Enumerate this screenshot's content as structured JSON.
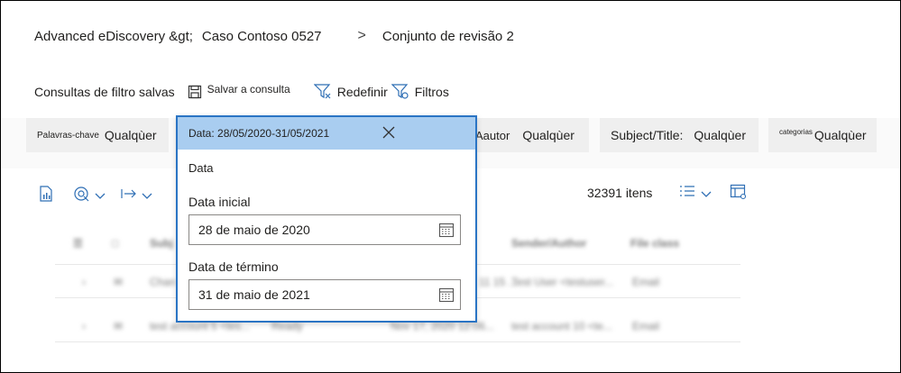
{
  "breadcrumb": {
    "app": "Advanced eDiscovery &gt;",
    "case": "Caso Contoso 0527",
    "separator": ">",
    "set": "Conjunto de revisão 2"
  },
  "toolbar": {
    "saved_queries": "Consultas de filtro salvas",
    "save_query": "Salvar a consulta",
    "reset": "Redefinir",
    "filters": "Filtros"
  },
  "filters": {
    "keywords_label": "Palavras-chave",
    "keywords_value": "Qualqùer",
    "author_label": "Aautor",
    "author_value": "Qualqùer",
    "subject_label": "Subject/Title:",
    "subject_value": "Qualqùer",
    "categories_label": "categorias",
    "categories_value": "Qualqùer"
  },
  "list": {
    "count": "32391 itens",
    "columns": [
      "Subj",
      "Sender/Author",
      "File class"
    ],
    "rows": [
      {
        "subject": "Chan",
        "date": "11 15 ...",
        "sender": "Test User <testuser...",
        "file_class": "Email"
      },
      {
        "subject": "test account 5 <tes...",
        "status": "Ready",
        "date": "Nov 17, 2020 12:06...",
        "sender": "test account 10 <te...",
        "file_class": "Email"
      }
    ]
  },
  "date_popup": {
    "header": "Data: 28/05/2020-31/05/2021",
    "title": "Data",
    "start_label": "Data inicial",
    "start_value": "28 de maio de 2020",
    "end_label": "Data de término",
    "end_value": "31 de maio de 2021"
  },
  "colors": {
    "accent": "#0078d4",
    "popup_border": "#2a74c4",
    "popup_header": "#a9cdf0"
  }
}
